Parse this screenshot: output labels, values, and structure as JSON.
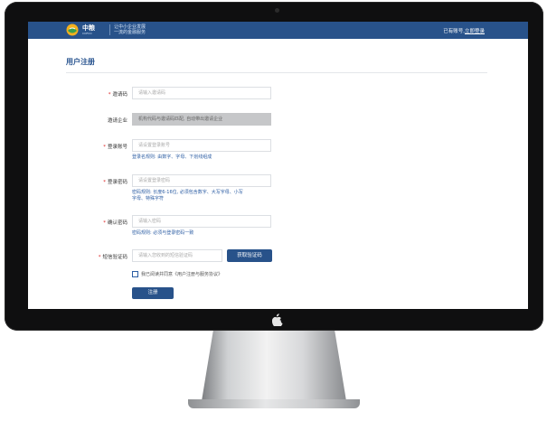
{
  "header": {
    "brand_name": "中粮",
    "brand_sub": "COFCO",
    "slogan_line1": "让中小企业发展",
    "slogan_line2": "一流的金融服务",
    "login_prompt": "已有账号,",
    "login_link": "立即登录"
  },
  "page": {
    "title": "用户注册"
  },
  "form": {
    "invite_code": {
      "label": "邀请码",
      "placeholder": "请输入邀请码"
    },
    "invite_company": {
      "label": "邀请企业",
      "value": "机构代码与邀请码匹配, 自动带出邀请企业"
    },
    "account": {
      "label": "登录账号",
      "placeholder": "请设置登录账号",
      "hint": "登录名规则: 由数字、字母、下划线组成"
    },
    "password": {
      "label": "登录密码",
      "placeholder": "请设置登录密码",
      "hint_line1": "密码规则: 长度6-16位, 必须包含数字、大写字母、小写",
      "hint_line2": "字母、特殊字符"
    },
    "confirm": {
      "label": "确认密码",
      "placeholder": "请输入密码",
      "hint": "密码规则: 必须与登录密码一致"
    },
    "sms": {
      "label": "短信验证码",
      "placeholder": "请输入您收到的短信验证码",
      "button": "获取验证码"
    },
    "agreement": "我已阅读并同意《用户注册与服务协议》",
    "submit": "注册"
  },
  "colors": {
    "brand": "#28528a",
    "hint": "#2c5da3",
    "required": "#dd2222"
  }
}
